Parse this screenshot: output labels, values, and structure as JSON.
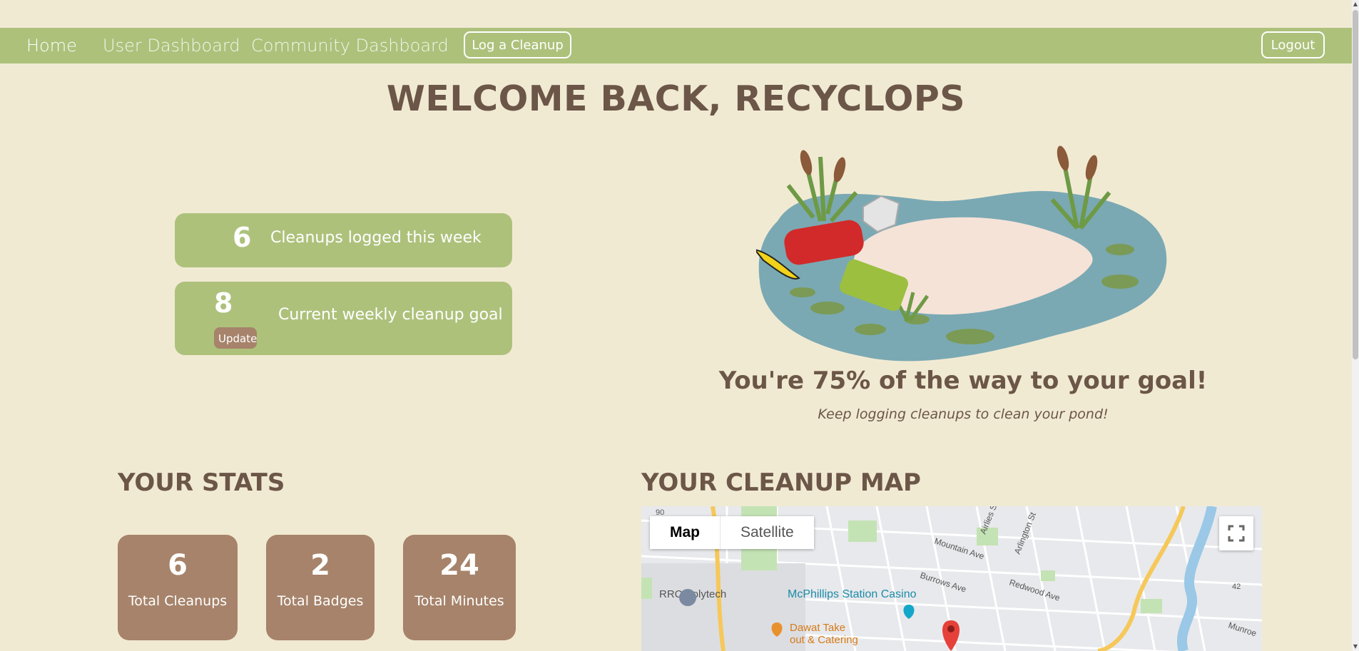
{
  "nav": {
    "home": "Home",
    "user_dashboard": "User Dashboard",
    "community_dashboard": "Community Dashboard",
    "log_cleanup": "Log a Cleanup",
    "logout": "Logout"
  },
  "welcome": {
    "title": "WELCOME BACK, RECYCLOPS"
  },
  "weekly": {
    "logged_count": "6",
    "logged_label": "Cleanups logged this week",
    "goal_count": "8",
    "goal_label": "Current weekly cleanup goal",
    "update_label": "Update"
  },
  "progress": {
    "percent": 75,
    "headline": "You're 75% of the way to your goal!",
    "subtext": "Keep logging cleanups to clean your pond!"
  },
  "stats": {
    "title": "YOUR STATS",
    "cards": [
      {
        "value": "6",
        "label": "Total Cleanups"
      },
      {
        "value": "2",
        "label": "Total Badges"
      },
      {
        "value": "24",
        "label": "Total Minutes"
      }
    ]
  },
  "map": {
    "title": "YOUR CLEANUP MAP",
    "toggle_map": "Map",
    "toggle_satellite": "Satellite",
    "labels": {
      "polytech": "RRC Polytech",
      "casino": "McPhillips Station Casino",
      "dawat_line1": "Dawat Take",
      "dawat_line2": "out & Catering",
      "mountain": "Mountain Ave",
      "burrows": "Burrows Ave",
      "redwood": "Redwood Ave",
      "airlies": "Airlies St",
      "arlington": "Arlington St",
      "munroe": "Munroe",
      "shield_90": "90",
      "shield_42": "42"
    }
  },
  "colors": {
    "background": "#f1ead3",
    "green": "#adc17b",
    "brown": "#a6836a",
    "text": "#6b5647"
  },
  "icons": {
    "fullscreen": "fullscreen-icon",
    "marker": "map-marker-icon",
    "school": "school-icon",
    "casino": "casino-icon",
    "restaurant": "restaurant-icon"
  }
}
